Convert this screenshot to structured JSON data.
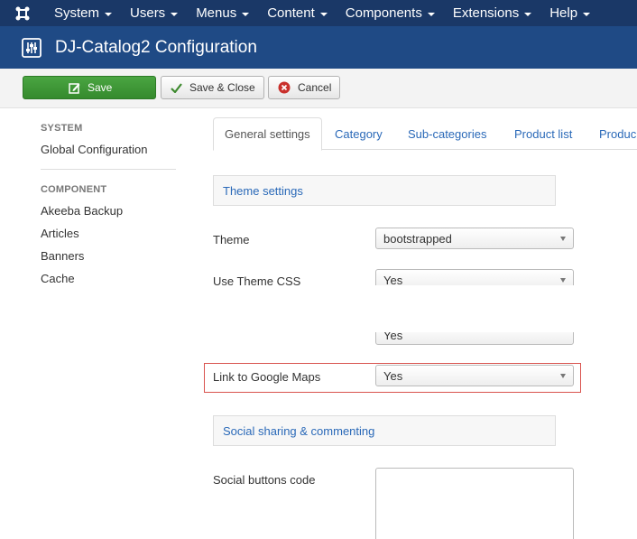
{
  "topnav": {
    "items": [
      {
        "label": "System"
      },
      {
        "label": "Users"
      },
      {
        "label": "Menus"
      },
      {
        "label": "Content"
      },
      {
        "label": "Components"
      },
      {
        "label": "Extensions"
      },
      {
        "label": "Help"
      }
    ]
  },
  "header": {
    "title": "DJ-Catalog2 Configuration"
  },
  "toolbar": {
    "save_label": "Save",
    "save_close_label": "Save & Close",
    "cancel_label": "Cancel"
  },
  "sidebar": {
    "system_heading": "SYSTEM",
    "global_config": "Global Configuration",
    "component_heading": "COMPONENT",
    "items": [
      {
        "label": "Akeeba Backup"
      },
      {
        "label": "Articles"
      },
      {
        "label": "Banners"
      },
      {
        "label": "Cache"
      }
    ]
  },
  "tabs": [
    {
      "label": "General settings"
    },
    {
      "label": "Category"
    },
    {
      "label": "Sub-categories"
    },
    {
      "label": "Product list"
    },
    {
      "label": "Produc"
    }
  ],
  "form": {
    "theme_settings_legend": "Theme settings",
    "theme_label": "Theme",
    "theme_value": "bootstrapped",
    "use_theme_css_label": "Use Theme CSS",
    "use_theme_css_value": "Yes",
    "partial_value": "Yes",
    "google_maps_label": "Link to Google Maps",
    "google_maps_value": "Yes",
    "social_legend": "Social sharing & commenting",
    "social_code_label": "Social buttons code"
  },
  "colors": {
    "nav_bg": "#1a3867",
    "header_bg": "#1f4a85",
    "save_green": "#3e9a36",
    "link_blue": "#2a69b8",
    "highlight_red": "#d9534f"
  }
}
